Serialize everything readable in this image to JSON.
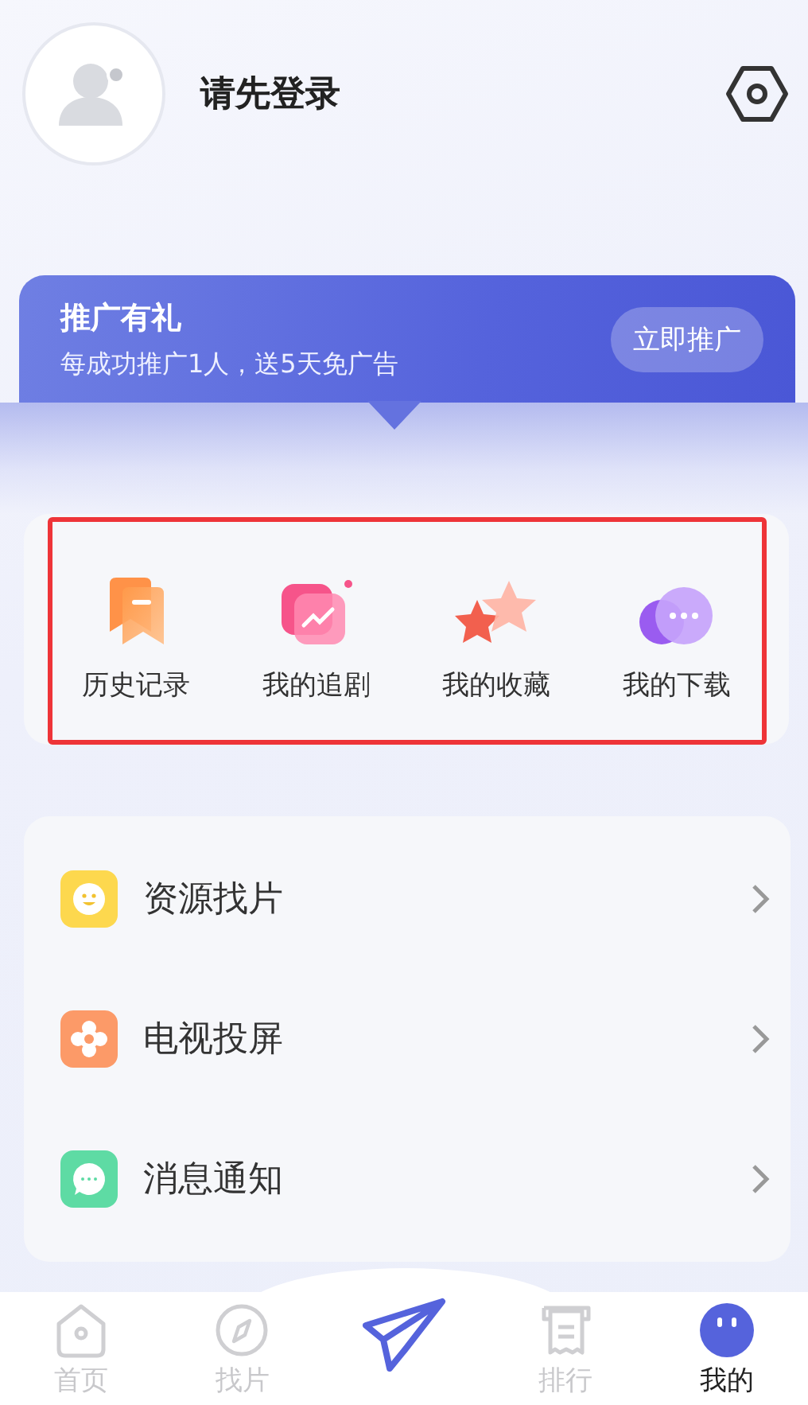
{
  "profile": {
    "login_prompt": "请先登录"
  },
  "promo": {
    "title": "推广有礼",
    "subtitle": "每成功推广1人，送5天免广告",
    "button": "立即推广"
  },
  "quick_actions": {
    "highlighted": true,
    "items": [
      {
        "label": "历史记录"
      },
      {
        "label": "我的追剧"
      },
      {
        "label": "我的收藏"
      },
      {
        "label": "我的下载"
      }
    ]
  },
  "menu": [
    {
      "label": "资源找片",
      "color": "#fdd84e"
    },
    {
      "label": "电视投屏",
      "color": "#fc9a68"
    },
    {
      "label": "消息通知",
      "color": "#5edba4"
    }
  ],
  "tab_bar": [
    {
      "kind": "tab",
      "label": "首页",
      "selected": false
    },
    {
      "kind": "tab",
      "label": "找片",
      "selected": false
    },
    {
      "kind": "center",
      "selected": false
    },
    {
      "kind": "tab",
      "label": "排行",
      "selected": false
    },
    {
      "kind": "tab",
      "label": "我的",
      "selected": true
    }
  ]
}
